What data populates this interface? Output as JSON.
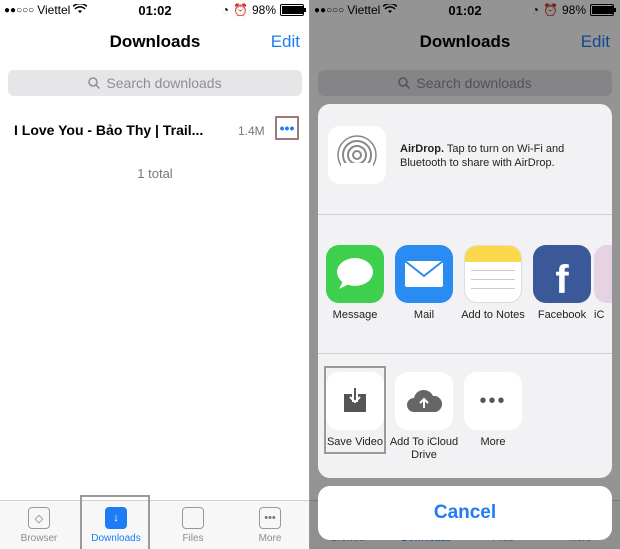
{
  "status": {
    "carrier": "Viettel",
    "time": "01:02",
    "battery": "98%"
  },
  "nav": {
    "title": "Downloads",
    "edit": "Edit"
  },
  "search": {
    "placeholder": "Search downloads"
  },
  "download": {
    "name": "I Love You - Bảo Thy | Trail...",
    "size": "1.4M",
    "more": "•••"
  },
  "total": "1 total",
  "tabs": [
    {
      "label": "Browser",
      "icon": "compass-icon"
    },
    {
      "label": "Downloads",
      "icon": "download-arrow-icon"
    },
    {
      "label": "Files",
      "icon": "file-icon"
    },
    {
      "label": "More",
      "icon": "ellipsis-icon"
    }
  ],
  "share": {
    "airdrop_title": "AirDrop.",
    "airdrop_text": "Tap to turn on Wi-Fi and Bluetooth to share with AirDrop.",
    "apps": [
      {
        "label": "Message",
        "color": "#3ecf4d",
        "icon": "message-bubble-icon"
      },
      {
        "label": "Mail",
        "color": "#2a8cf0",
        "icon": "envelope-icon"
      },
      {
        "label": "Add to Notes",
        "color": "#fbd94a",
        "icon": "notes-icon"
      },
      {
        "label": "Facebook",
        "color": "#3b5998",
        "icon": "facebook-icon"
      },
      {
        "label": "iC",
        "color": "#e7d2e3",
        "icon": "partial-app-icon"
      }
    ],
    "actions": [
      {
        "label": "Save Video",
        "icon": "save-video-icon"
      },
      {
        "label": "Add To iCloud Drive",
        "icon": "icloud-upload-icon"
      },
      {
        "label": "More",
        "icon": "more-dots-icon"
      }
    ],
    "cancel": "Cancel"
  },
  "colors": {
    "accent": "#1e7cf5"
  }
}
